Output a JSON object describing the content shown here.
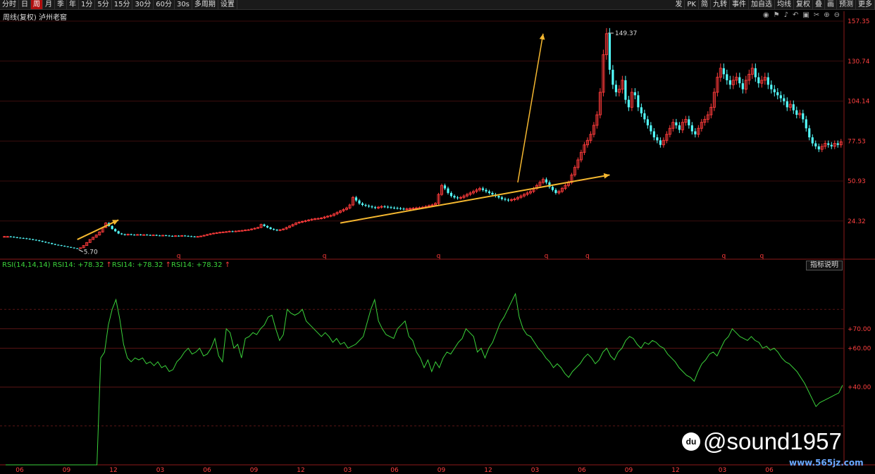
{
  "toolbar": {
    "left": [
      "分时",
      "日",
      "周",
      "月",
      "季",
      "年",
      "1分",
      "5分",
      "15分",
      "30分",
      "60分",
      "30s",
      "多周期",
      "设置"
    ],
    "active": "周",
    "right": [
      "发",
      "PK",
      "简",
      "九转",
      "事件",
      "加自选",
      "均线",
      "复权",
      "叠",
      "画",
      "预测",
      "更多"
    ]
  },
  "symbol": {
    "period": "周线(复权)",
    "name": "泸州老窖"
  },
  "price_axis": {
    "labels": [
      "157.35",
      "130.74",
      "104.14",
      "77.53",
      "50.93",
      "24.32"
    ]
  },
  "annotations": {
    "low": "5.70",
    "high": "149.37"
  },
  "q_marks": [
    "q",
    "q",
    "q",
    "q",
    "q",
    "q",
    "q"
  ],
  "indicator": {
    "title": "RSI(14,14,14)",
    "label1": "RSI14: +78.32",
    "label2": "RSI14: +78.32",
    "label3": "RSI14: +78.32",
    "button": "指标说明",
    "axis_labels": [
      "+70.00",
      "+60.00",
      "+40.00"
    ]
  },
  "x_axis": {
    "labels": [
      "06",
      "09",
      "12",
      "03",
      "06",
      "09",
      "12",
      "03",
      "06",
      "09",
      "12",
      "03",
      "06",
      "09",
      "12",
      "03",
      "06"
    ]
  },
  "watermark": {
    "logo": "du",
    "text": "@sound1957",
    "site": "www.565jz.com"
  },
  "chart_data": [
    {
      "type": "candlestick",
      "title": "泸州老窖 周线(复权)",
      "ylim": [
        5,
        157.35
      ],
      "ticks": [
        157.35,
        130.74,
        104.14,
        77.53,
        50.93,
        24.32
      ],
      "low_mark": 5.7,
      "high_mark": 149.37,
      "close": [
        14,
        14,
        13.8,
        13.5,
        13.2,
        13,
        12.8,
        12.5,
        12.2,
        11.8,
        11.5,
        11,
        10.5,
        10,
        9.6,
        9,
        8.5,
        8.2,
        7.8,
        7.4,
        7,
        6.6,
        6.2,
        6,
        6.5,
        8,
        10,
        12,
        13.5,
        15,
        17,
        20,
        23,
        21,
        19,
        17.5,
        16,
        15.5,
        15,
        15.5,
        15.2,
        15,
        15.3,
        15,
        15.2,
        15,
        14.8,
        15,
        14.7,
        14.5,
        14.8,
        14.6,
        14.4,
        14.2,
        14.5,
        14.3,
        14.6,
        14.4,
        14.2,
        14,
        13.8,
        14,
        14.3,
        14.8,
        15.3,
        15.8,
        16.2,
        16.5,
        16.8,
        17,
        17.2,
        17.5,
        17.3,
        17.6,
        17.8,
        18,
        18.3,
        18.5,
        19,
        19.5,
        20,
        22,
        21,
        20,
        19,
        18.5,
        18,
        18.5,
        19,
        20,
        21,
        22,
        23,
        23.5,
        24,
        24.5,
        25,
        25.5,
        25.8,
        26,
        26.3,
        27,
        27.5,
        28,
        29,
        30,
        31,
        32,
        33,
        35,
        40,
        38,
        36,
        35,
        34.5,
        34,
        33.5,
        33,
        33.5,
        34,
        33.8,
        33.5,
        33.2,
        33,
        32.8,
        32.5,
        32.2,
        32.4,
        32.6,
        32.8,
        33,
        33.2,
        33.5,
        34,
        34.5,
        35,
        36,
        42,
        48,
        46,
        43,
        41,
        40,
        39.5,
        40,
        41,
        42,
        43,
        44,
        45,
        46,
        45,
        44,
        43,
        42,
        41,
        40,
        39,
        38.5,
        38,
        38.5,
        39,
        40,
        41,
        42,
        43,
        44,
        46,
        48,
        50,
        52,
        50,
        47,
        45,
        43,
        44,
        46,
        48,
        50,
        55,
        60,
        65,
        70,
        75,
        78,
        82,
        88,
        95,
        110,
        135,
        149,
        125,
        115,
        110,
        112,
        118,
        105,
        100,
        110,
        108,
        100,
        96,
        92,
        88,
        84,
        80,
        78,
        75,
        78,
        82,
        86,
        90,
        88,
        85,
        90,
        92,
        88,
        84,
        82,
        86,
        90,
        92,
        95,
        100,
        110,
        120,
        126,
        122,
        118,
        115,
        118,
        120,
        116,
        112,
        118,
        122,
        126,
        120,
        116,
        118,
        120,
        115,
        112,
        110,
        108,
        106,
        104,
        100,
        102,
        98,
        95,
        96,
        92,
        86,
        80,
        76,
        74,
        72,
        74,
        76,
        75,
        74,
        76,
        75,
        77
      ]
    },
    {
      "type": "line",
      "title": "RSI(14,14,14)",
      "ylim": [
        0,
        100
      ],
      "ticks": [
        70,
        60,
        40
      ],
      "series": [
        {
          "name": "RSI14",
          "values": [
            0,
            0,
            0,
            0,
            0,
            0,
            0,
            0,
            0,
            0,
            0,
            0,
            0,
            0,
            0,
            0,
            0,
            0,
            0,
            0,
            0,
            0,
            0,
            0,
            0,
            55,
            58,
            72,
            80,
            85,
            75,
            62,
            55,
            53,
            55,
            54,
            55,
            52,
            53,
            51,
            53,
            50,
            51,
            48,
            49,
            53,
            55,
            58,
            60,
            57,
            58,
            60,
            56,
            57,
            60,
            65,
            56,
            53,
            70,
            68,
            60,
            62,
            55,
            65,
            66,
            68,
            67,
            70,
            72,
            76,
            77,
            70,
            64,
            67,
            80,
            78,
            77,
            78,
            80,
            74,
            72,
            70,
            68,
            66,
            68,
            66,
            63,
            65,
            62,
            63,
            60,
            61,
            62,
            64,
            66,
            73,
            80,
            85,
            74,
            70,
            67,
            66,
            65,
            70,
            72,
            74,
            66,
            64,
            58,
            55,
            50,
            54,
            48,
            53,
            50,
            55,
            58,
            57,
            60,
            63,
            65,
            70,
            68,
            66,
            58,
            60,
            55,
            60,
            63,
            68,
            73,
            76,
            80,
            84,
            88,
            76,
            70,
            67,
            66,
            63,
            60,
            58,
            55,
            53,
            50,
            52,
            50,
            47,
            45,
            48,
            50,
            52,
            55,
            57,
            55,
            52,
            54,
            58,
            60,
            56,
            54,
            58,
            60,
            64,
            66,
            65,
            62,
            60,
            63,
            62,
            64,
            63,
            61,
            60,
            57,
            55,
            53,
            50,
            48,
            46,
            45,
            43,
            48,
            52,
            54,
            57,
            58,
            56,
            60,
            64,
            66,
            70,
            68,
            66,
            65,
            64,
            66,
            64,
            63,
            60,
            61,
            59,
            60,
            58,
            55,
            53,
            52,
            50,
            48,
            45,
            42,
            38,
            34,
            30,
            32,
            33,
            34,
            35,
            36,
            37,
            41
          ]
        }
      ]
    }
  ]
}
